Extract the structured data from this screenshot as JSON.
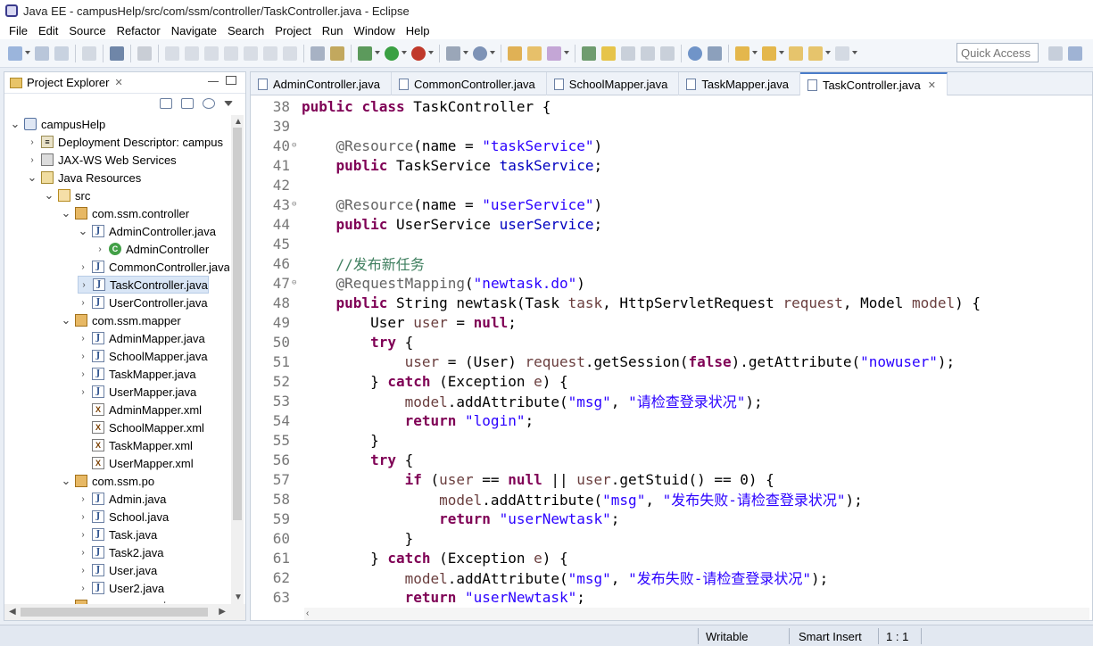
{
  "window": {
    "title": "Java EE - campusHelp/src/com/ssm/controller/TaskController.java - Eclipse"
  },
  "menu": [
    "File",
    "Edit",
    "Source",
    "Refactor",
    "Navigate",
    "Search",
    "Project",
    "Run",
    "Window",
    "Help"
  ],
  "toolbar": {
    "quick_access_placeholder": "Quick Access"
  },
  "explorer": {
    "title": "Project Explorer",
    "tree": [
      {
        "label": "campusHelp",
        "icon": "project-icon",
        "depth": 0,
        "twisty": "open"
      },
      {
        "label": "Deployment Descriptor: campus",
        "icon": "descriptor-icon",
        "depth": 1,
        "twisty": "closed"
      },
      {
        "label": "JAX-WS Web Services",
        "icon": "webservice-icon",
        "depth": 1,
        "twisty": "closed"
      },
      {
        "label": "Java Resources",
        "icon": "resources-icon",
        "depth": 1,
        "twisty": "open"
      },
      {
        "label": "src",
        "icon": "source-folder-icon",
        "depth": 2,
        "twisty": "open"
      },
      {
        "label": "com.ssm.controller",
        "icon": "package-icon",
        "depth": 3,
        "twisty": "open"
      },
      {
        "label": "AdminController.java",
        "icon": "java-file-icon",
        "depth": 4,
        "twisty": "open"
      },
      {
        "label": "AdminController",
        "icon": "class-icon",
        "depth": 5,
        "twisty": "closed"
      },
      {
        "label": "CommonController.java",
        "icon": "java-file-icon",
        "depth": 4,
        "twisty": "closed"
      },
      {
        "label": "TaskController.java",
        "icon": "java-file-icon",
        "depth": 4,
        "twisty": "closed",
        "selected": true
      },
      {
        "label": "UserController.java",
        "icon": "java-file-icon",
        "depth": 4,
        "twisty": "closed"
      },
      {
        "label": "com.ssm.mapper",
        "icon": "package-icon",
        "depth": 3,
        "twisty": "open"
      },
      {
        "label": "AdminMapper.java",
        "icon": "java-file-icon",
        "depth": 4,
        "twisty": "closed"
      },
      {
        "label": "SchoolMapper.java",
        "icon": "java-file-icon",
        "depth": 4,
        "twisty": "closed"
      },
      {
        "label": "TaskMapper.java",
        "icon": "java-file-icon",
        "depth": 4,
        "twisty": "closed"
      },
      {
        "label": "UserMapper.java",
        "icon": "java-file-icon",
        "depth": 4,
        "twisty": "closed"
      },
      {
        "label": "AdminMapper.xml",
        "icon": "xml-file-icon",
        "depth": 4,
        "twisty": "none"
      },
      {
        "label": "SchoolMapper.xml",
        "icon": "xml-file-icon",
        "depth": 4,
        "twisty": "none"
      },
      {
        "label": "TaskMapper.xml",
        "icon": "xml-file-icon",
        "depth": 4,
        "twisty": "none"
      },
      {
        "label": "UserMapper.xml",
        "icon": "xml-file-icon",
        "depth": 4,
        "twisty": "none"
      },
      {
        "label": "com.ssm.po",
        "icon": "package-icon",
        "depth": 3,
        "twisty": "open"
      },
      {
        "label": "Admin.java",
        "icon": "java-file-icon",
        "depth": 4,
        "twisty": "closed"
      },
      {
        "label": "School.java",
        "icon": "java-file-icon",
        "depth": 4,
        "twisty": "closed"
      },
      {
        "label": "Task.java",
        "icon": "java-file-icon",
        "depth": 4,
        "twisty": "closed"
      },
      {
        "label": "Task2.java",
        "icon": "java-file-icon",
        "depth": 4,
        "twisty": "closed"
      },
      {
        "label": "User.java",
        "icon": "java-file-icon",
        "depth": 4,
        "twisty": "closed"
      },
      {
        "label": "User2.java",
        "icon": "java-file-icon",
        "depth": 4,
        "twisty": "closed"
      },
      {
        "label": "com.ssm.service",
        "icon": "package-icon",
        "depth": 3,
        "twisty": "open"
      }
    ]
  },
  "editor": {
    "tabs": [
      {
        "label": "AdminController.java",
        "active": false
      },
      {
        "label": "CommonController.java",
        "active": false
      },
      {
        "label": "SchoolMapper.java",
        "active": false
      },
      {
        "label": "TaskMapper.java",
        "active": false
      },
      {
        "label": "TaskController.java",
        "active": true
      }
    ],
    "lines": [
      {
        "num": "38",
        "fold": "",
        "tokens": [
          [
            "kw",
            "public"
          ],
          [
            "t",
            " "
          ],
          [
            "kw",
            "class"
          ],
          [
            "t",
            " TaskController {"
          ]
        ]
      },
      {
        "num": "39",
        "fold": "",
        "tokens": []
      },
      {
        "num": "40",
        "fold": "⊖",
        "tokens": [
          [
            "t",
            "    "
          ],
          [
            "ann",
            "@Resource"
          ],
          [
            "t",
            "(name = "
          ],
          [
            "str",
            "\"taskService\""
          ],
          [
            "t",
            ")"
          ]
        ]
      },
      {
        "num": "41",
        "fold": "",
        "tokens": [
          [
            "t",
            "    "
          ],
          [
            "kw",
            "public"
          ],
          [
            "t",
            " TaskService "
          ],
          [
            "fld",
            "taskService"
          ],
          [
            "t",
            ";"
          ]
        ]
      },
      {
        "num": "42",
        "fold": "",
        "tokens": []
      },
      {
        "num": "43",
        "fold": "⊖",
        "tokens": [
          [
            "t",
            "    "
          ],
          [
            "ann",
            "@Resource"
          ],
          [
            "t",
            "(name = "
          ],
          [
            "str",
            "\"userService\""
          ],
          [
            "t",
            ")"
          ]
        ]
      },
      {
        "num": "44",
        "fold": "",
        "tokens": [
          [
            "t",
            "    "
          ],
          [
            "kw",
            "public"
          ],
          [
            "t",
            " UserService "
          ],
          [
            "fld",
            "userService"
          ],
          [
            "t",
            ";"
          ]
        ]
      },
      {
        "num": "45",
        "fold": "",
        "tokens": []
      },
      {
        "num": "46",
        "fold": "",
        "tokens": [
          [
            "t",
            "    "
          ],
          [
            "cmt",
            "//发布新任务"
          ]
        ]
      },
      {
        "num": "47",
        "fold": "⊖",
        "tokens": [
          [
            "t",
            "    "
          ],
          [
            "ann",
            "@RequestMapping"
          ],
          [
            "t",
            "("
          ],
          [
            "str",
            "\"newtask.do\""
          ],
          [
            "t",
            ")"
          ]
        ]
      },
      {
        "num": "48",
        "fold": "",
        "tokens": [
          [
            "t",
            "    "
          ],
          [
            "kw",
            "public"
          ],
          [
            "t",
            " String newtask(Task "
          ],
          [
            "var",
            "task"
          ],
          [
            "t",
            ", HttpServletRequest "
          ],
          [
            "var",
            "request"
          ],
          [
            "t",
            ", Model "
          ],
          [
            "var",
            "model"
          ],
          [
            "t",
            ") {"
          ]
        ]
      },
      {
        "num": "49",
        "fold": "",
        "tokens": [
          [
            "t",
            "        User "
          ],
          [
            "var",
            "user"
          ],
          [
            "t",
            " = "
          ],
          [
            "kw",
            "null"
          ],
          [
            "t",
            ";"
          ]
        ]
      },
      {
        "num": "50",
        "fold": "",
        "tokens": [
          [
            "t",
            "        "
          ],
          [
            "kw",
            "try"
          ],
          [
            "t",
            " {"
          ]
        ]
      },
      {
        "num": "51",
        "fold": "",
        "tokens": [
          [
            "t",
            "            "
          ],
          [
            "var",
            "user"
          ],
          [
            "t",
            " = (User) "
          ],
          [
            "var",
            "request"
          ],
          [
            "t",
            ".getSession("
          ],
          [
            "kw",
            "false"
          ],
          [
            "t",
            ").getAttribute("
          ],
          [
            "str",
            "\"nowuser\""
          ],
          [
            "t",
            ");"
          ]
        ]
      },
      {
        "num": "52",
        "fold": "",
        "tokens": [
          [
            "t",
            "        } "
          ],
          [
            "kw",
            "catch"
          ],
          [
            "t",
            " (Exception "
          ],
          [
            "var",
            "e"
          ],
          [
            "t",
            ") {"
          ]
        ]
      },
      {
        "num": "53",
        "fold": "",
        "tokens": [
          [
            "t",
            "            "
          ],
          [
            "var",
            "model"
          ],
          [
            "t",
            ".addAttribute("
          ],
          [
            "str",
            "\"msg\""
          ],
          [
            "t",
            ", "
          ],
          [
            "str",
            "\"请检查登录状况\""
          ],
          [
            "t",
            ");"
          ]
        ]
      },
      {
        "num": "54",
        "fold": "",
        "tokens": [
          [
            "t",
            "            "
          ],
          [
            "kw",
            "return"
          ],
          [
            "t",
            " "
          ],
          [
            "str",
            "\"login\""
          ],
          [
            "t",
            ";"
          ]
        ]
      },
      {
        "num": "55",
        "fold": "",
        "tokens": [
          [
            "t",
            "        }"
          ]
        ]
      },
      {
        "num": "56",
        "fold": "",
        "tokens": [
          [
            "t",
            "        "
          ],
          [
            "kw",
            "try"
          ],
          [
            "t",
            " {"
          ]
        ]
      },
      {
        "num": "57",
        "fold": "",
        "tokens": [
          [
            "t",
            "            "
          ],
          [
            "kw",
            "if"
          ],
          [
            "t",
            " ("
          ],
          [
            "var",
            "user"
          ],
          [
            "t",
            " == "
          ],
          [
            "kw",
            "null"
          ],
          [
            "t",
            " || "
          ],
          [
            "var",
            "user"
          ],
          [
            "t",
            ".getStuid() == 0) {"
          ]
        ]
      },
      {
        "num": "58",
        "fold": "",
        "tokens": [
          [
            "t",
            "                "
          ],
          [
            "var",
            "model"
          ],
          [
            "t",
            ".addAttribute("
          ],
          [
            "str",
            "\"msg\""
          ],
          [
            "t",
            ", "
          ],
          [
            "str",
            "\"发布失败-请检查登录状况\""
          ],
          [
            "t",
            ");"
          ]
        ]
      },
      {
        "num": "59",
        "fold": "",
        "tokens": [
          [
            "t",
            "                "
          ],
          [
            "kw",
            "return"
          ],
          [
            "t",
            " "
          ],
          [
            "str",
            "\"userNewtask\""
          ],
          [
            "t",
            ";"
          ]
        ]
      },
      {
        "num": "60",
        "fold": "",
        "tokens": [
          [
            "t",
            "            }"
          ]
        ]
      },
      {
        "num": "61",
        "fold": "",
        "tokens": [
          [
            "t",
            "        } "
          ],
          [
            "kw",
            "catch"
          ],
          [
            "t",
            " (Exception "
          ],
          [
            "var",
            "e"
          ],
          [
            "t",
            ") {"
          ]
        ]
      },
      {
        "num": "62",
        "fold": "",
        "tokens": [
          [
            "t",
            "            "
          ],
          [
            "var",
            "model"
          ],
          [
            "t",
            ".addAttribute("
          ],
          [
            "str",
            "\"msg\""
          ],
          [
            "t",
            ", "
          ],
          [
            "str",
            "\"发布失败-请检查登录状况\""
          ],
          [
            "t",
            ");"
          ]
        ]
      },
      {
        "num": "63",
        "fold": "",
        "tokens": [
          [
            "t",
            "            "
          ],
          [
            "kw",
            "return"
          ],
          [
            "t",
            " "
          ],
          [
            "str",
            "\"userNewtask\""
          ],
          [
            "t",
            ";"
          ]
        ]
      }
    ]
  },
  "status": {
    "writable": "Writable",
    "insert_mode": "Smart Insert",
    "position": "1 : 1"
  }
}
